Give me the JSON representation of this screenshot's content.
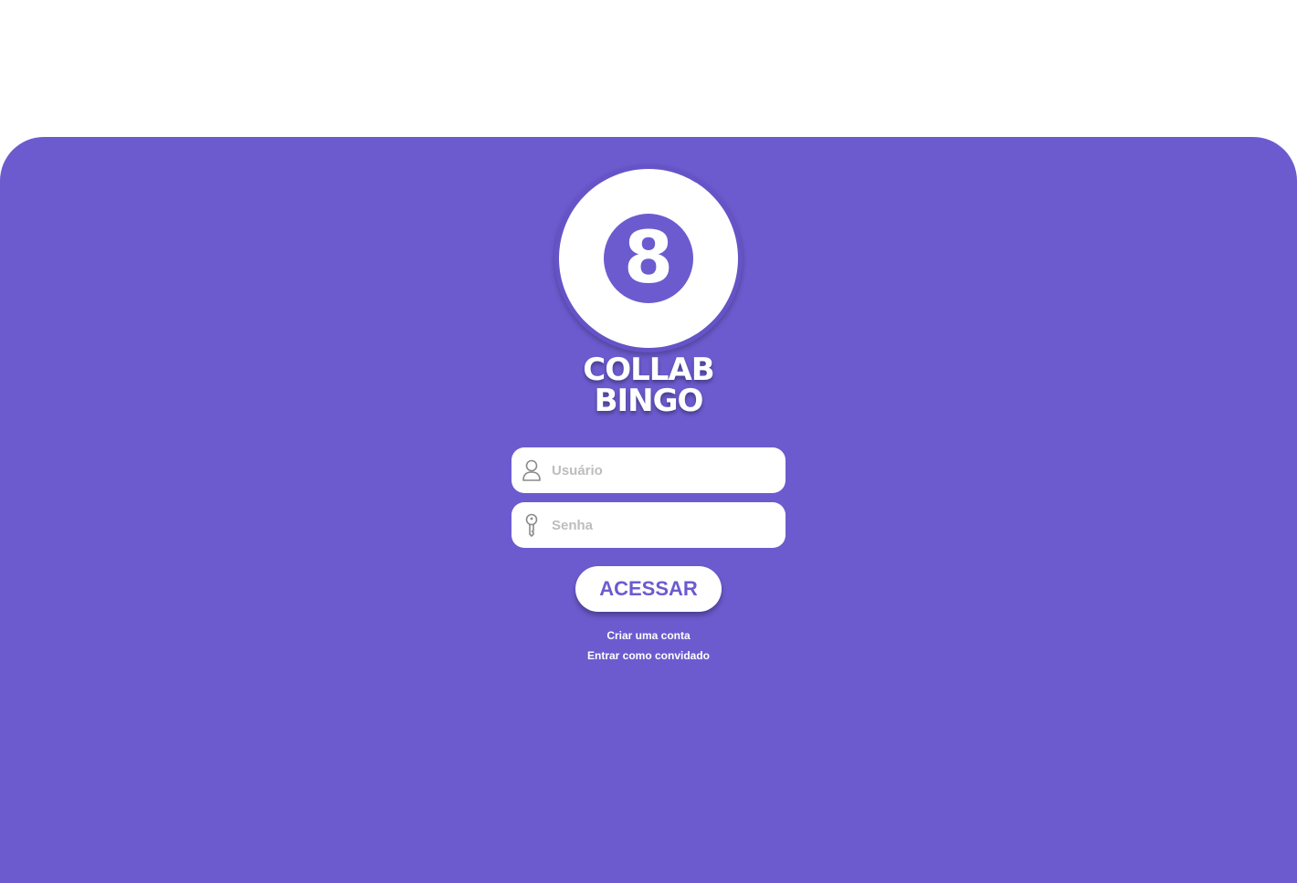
{
  "logo": {
    "number": "8"
  },
  "title": {
    "line1": "COLLAB",
    "line2": "BINGO"
  },
  "form": {
    "username": {
      "placeholder": "Usuário",
      "value": "",
      "icon": "user-icon"
    },
    "password": {
      "placeholder": "Senha",
      "value": "",
      "icon": "key-icon"
    },
    "submit_label": "ACESSAR"
  },
  "links": {
    "create_account": "Criar uma conta",
    "guest_login": "Entrar como convidado"
  },
  "colors": {
    "primary": "#6c5bcf",
    "background": "#ffffff",
    "field": "#ffffff",
    "placeholder": "#bdbdbd"
  }
}
